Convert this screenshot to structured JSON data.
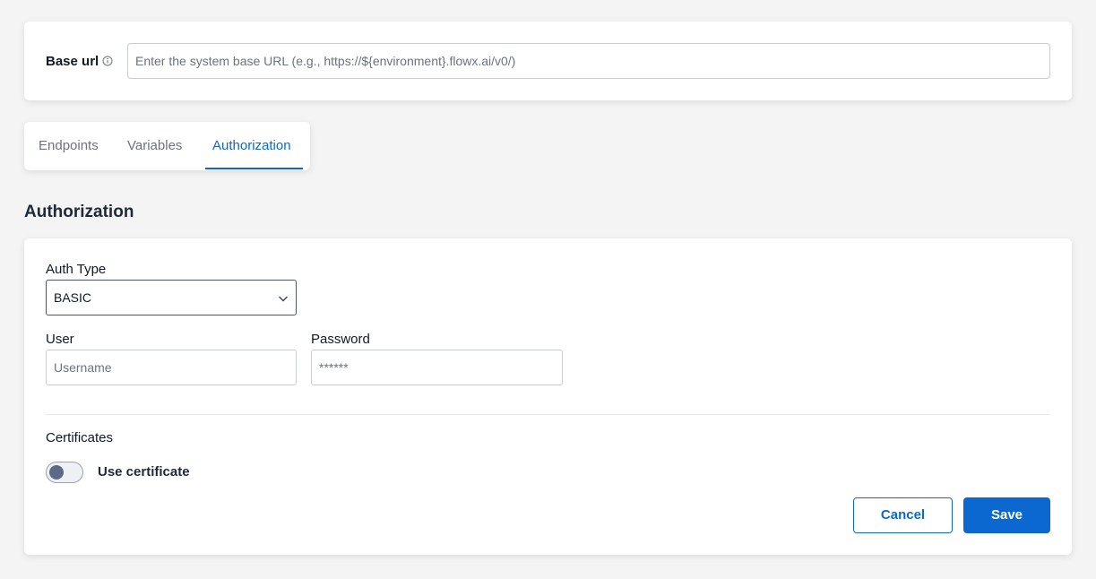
{
  "base_url": {
    "label": "Base url",
    "info_icon": "info-circle-icon",
    "placeholder": "Enter the system base URL (e.g., https://${environment}.flowx.ai/v0/)",
    "value": ""
  },
  "tabs": [
    {
      "label": "Endpoints",
      "active": false
    },
    {
      "label": "Variables",
      "active": false
    },
    {
      "label": "Authorization",
      "active": true
    }
  ],
  "section_title": "Authorization",
  "auth": {
    "auth_type_label": "Auth Type",
    "auth_type_value": "BASIC",
    "user_label": "User",
    "user_placeholder": "Username",
    "password_label": "Password",
    "password_placeholder": "******",
    "certificates_label": "Certificates",
    "use_certificate_label": "Use certificate",
    "use_certificate_enabled": false
  },
  "buttons": {
    "cancel": "Cancel",
    "save": "Save"
  },
  "colors": {
    "accent": "#0b68d0",
    "background": "#f4f4f4",
    "toggle_knob": "#5b6b86"
  }
}
